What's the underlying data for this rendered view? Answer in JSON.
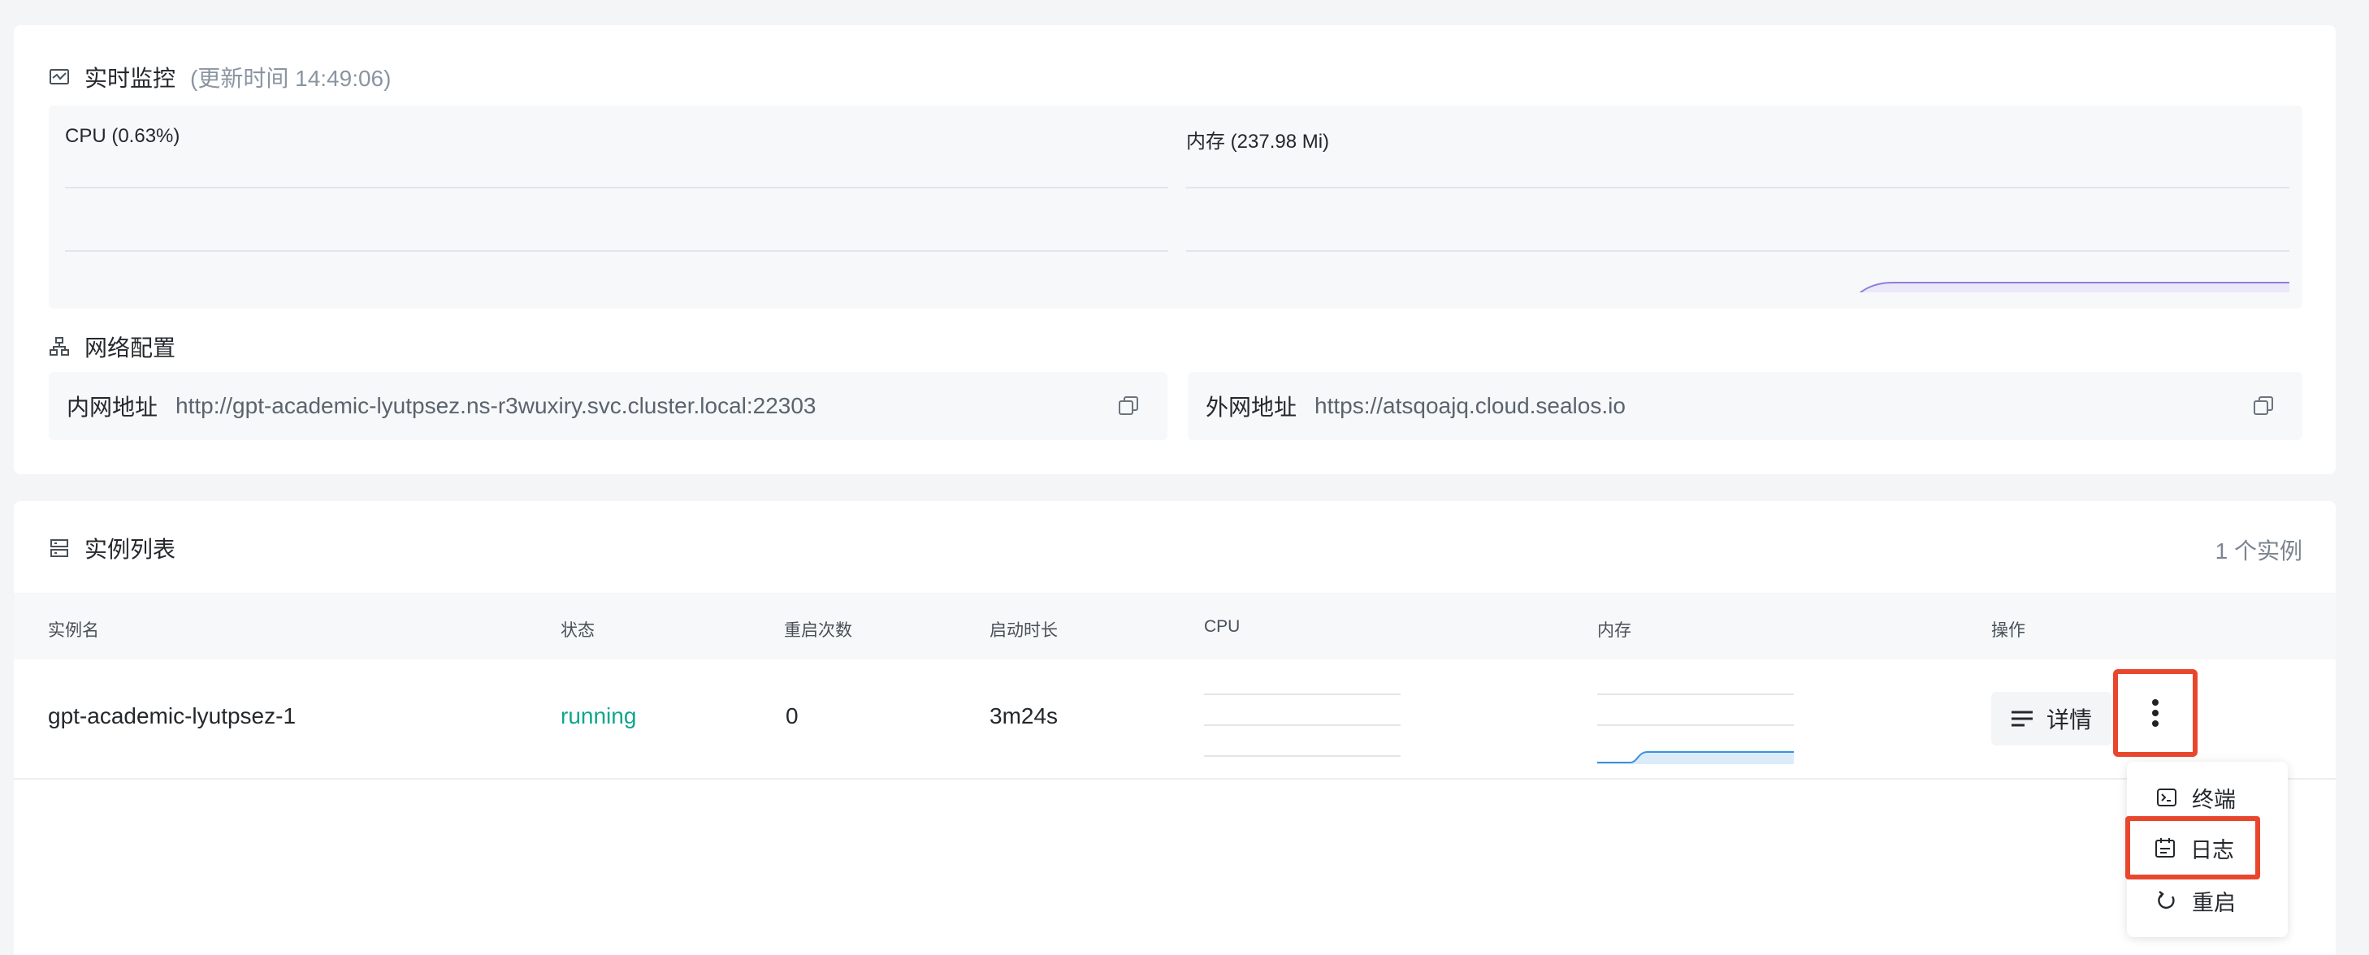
{
  "monitor": {
    "title": "实时监控",
    "update_time": "(更新时间  14:49:06)",
    "cpu_label": "CPU  (0.63%)",
    "memory_label": "内存  (237.98 Mi)",
    "cpu_color": "#3ba7e1",
    "memory_color": "#8f7fd9"
  },
  "network": {
    "title": "网络配置",
    "internal_label": "内网地址",
    "internal_value": "http://gpt-academic-lyutpsez.ns-r3wuxiry.svc.cluster.local:22303",
    "external_label": "外网地址",
    "external_value": "https://atsqoajq.cloud.sealos.io"
  },
  "instances": {
    "title": "实例列表",
    "count_label": "1 个实例",
    "columns": [
      "实例名",
      "状态",
      "重启次数",
      "启动时长",
      "CPU",
      "内存",
      "操作"
    ],
    "rows": [
      {
        "name": "gpt-academic-lyutpsez-1",
        "status": "running",
        "restarts": "0",
        "uptime": "3m24s"
      }
    ],
    "detail_button": "详情"
  },
  "menu": {
    "items": [
      {
        "label": "终端",
        "icon": "terminal-icon"
      },
      {
        "label": "日志",
        "icon": "log-icon"
      },
      {
        "label": "重启",
        "icon": "restart-icon"
      }
    ]
  },
  "colors": {
    "highlight": "#e8472e",
    "running": "#0ea58f"
  }
}
